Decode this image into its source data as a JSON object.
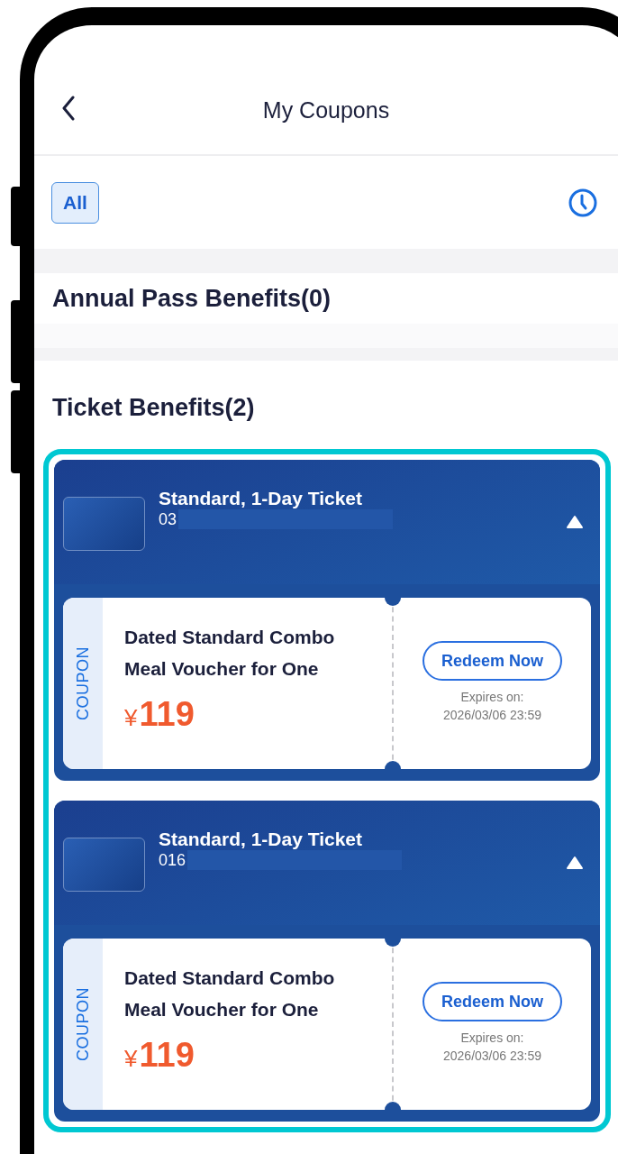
{
  "header": {
    "title": "My Coupons"
  },
  "filters": [
    {
      "label": "All",
      "selected": true
    }
  ],
  "sections": [
    {
      "title": "Annual Pass Benefits(0)"
    },
    {
      "title": "Ticket Benefits(2)",
      "tickets": [
        {
          "name": "Standard, 1-Day Ticket",
          "number": "03",
          "expanded": true,
          "coupons": [
            {
              "tag": "COUPON",
              "title": "Dated Standard Combo Meal Voucher for One",
              "currency": "¥",
              "price": "119",
              "button": "Redeem Now",
              "expiry_label": "Expires on:",
              "expiry": "2026/03/06 23:59"
            }
          ]
        },
        {
          "name": "Standard, 1-Day Ticket",
          "number": "016",
          "expanded": true,
          "coupons": [
            {
              "tag": "COUPON",
              "title": "Dated Standard Combo Meal Voucher for One",
              "currency": "¥",
              "price": "119",
              "button": "Redeem Now",
              "expiry_label": "Expires on:",
              "expiry": "2026/03/06 23:59"
            }
          ]
        }
      ]
    }
  ]
}
